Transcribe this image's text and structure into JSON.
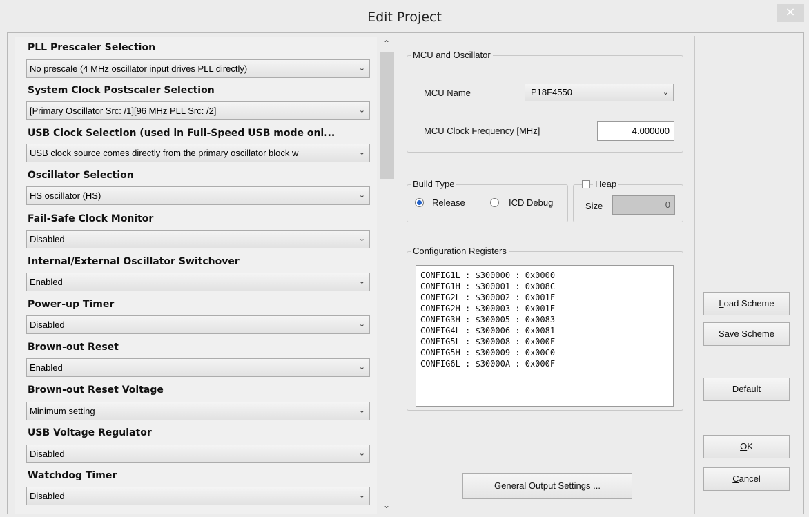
{
  "window": {
    "title": "Edit Project",
    "close_glyph": "×"
  },
  "options": [
    {
      "label": "PLL Prescaler Selection",
      "value": "No prescale (4 MHz oscillator input drives PLL directly)"
    },
    {
      "label": "System Clock Postscaler Selection",
      "value": "[Primary Oscillator Src: /1][96 MHz PLL Src: /2]"
    },
    {
      "label": "USB Clock Selection (used in Full-Speed USB mode onl...",
      "value": "USB clock source comes directly from the primary oscillator block w"
    },
    {
      "label": "Oscillator Selection",
      "value": "HS oscillator (HS)"
    },
    {
      "label": "Fail-Safe Clock Monitor",
      "value": "Disabled"
    },
    {
      "label": "Internal/External Oscillator Switchover",
      "value": "Enabled"
    },
    {
      "label": "Power-up Timer",
      "value": "Disabled"
    },
    {
      "label": "Brown-out Reset",
      "value": "Enabled"
    },
    {
      "label": "Brown-out Reset Voltage",
      "value": "Minimum setting"
    },
    {
      "label": "USB Voltage Regulator",
      "value": "Disabled"
    },
    {
      "label": "Watchdog Timer",
      "value": "Disabled"
    }
  ],
  "mcu": {
    "group_title": "MCU and Oscillator",
    "name_label": "MCU Name",
    "name_value": "P18F4550",
    "freq_label": "MCU Clock Frequency [MHz]",
    "freq_value": "4.000000"
  },
  "build": {
    "group_title": "Build Type",
    "release_label": "Release",
    "icd_label": "ICD Debug",
    "selected": "Release"
  },
  "heap": {
    "title": "Heap",
    "checked": false,
    "size_label": "Size",
    "size_value": "0"
  },
  "config": {
    "group_title": "Configuration Registers",
    "lines": [
      "CONFIG1L : $300000 : 0x0000",
      "CONFIG1H : $300001 : 0x008C",
      "CONFIG2L : $300002 : 0x001F",
      "CONFIG2H : $300003 : 0x001E",
      "CONFIG3H : $300005 : 0x0083",
      "CONFIG4L : $300006 : 0x0081",
      "CONFIG5L : $300008 : 0x000F",
      "CONFIG5H : $300009 : 0x00C0",
      "CONFIG6L : $30000A : 0x000F"
    ]
  },
  "buttons": {
    "general_output": "General Output Settings ...",
    "load_scheme": {
      "mnemonic": "L",
      "rest": "oad Scheme"
    },
    "save_scheme": {
      "mnemonic": "S",
      "rest": "ave Scheme"
    },
    "default": {
      "mnemonic": "D",
      "rest": "efault"
    },
    "ok": {
      "mnemonic": "O",
      "rest": "K"
    },
    "cancel": {
      "mnemonic": "C",
      "rest": "ancel"
    }
  },
  "icons": {
    "chevron": "chevron-down-icon",
    "scroll_up": "caret-up-icon",
    "scroll_down": "caret-down-icon"
  }
}
